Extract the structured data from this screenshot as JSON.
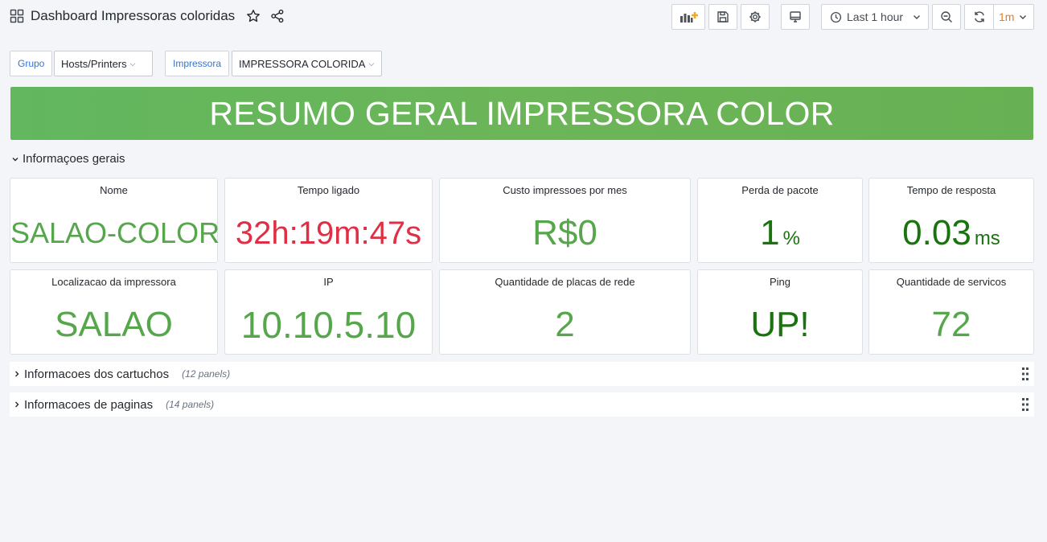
{
  "header": {
    "title": "Dashboard Impressoras coloridas",
    "time_range": "Last 1 hour",
    "refresh_interval": "1m"
  },
  "variables": [
    {
      "label": "Grupo",
      "value": "Hosts/Printers"
    },
    {
      "label": "Impressora",
      "value": "IMPRESSORA COLORIDA"
    }
  ],
  "banner": {
    "text": "RESUMO GERAL IMPRESSORA COLOR"
  },
  "rows": {
    "general": {
      "title": "Informaçoes gerais"
    },
    "cartridges": {
      "title": "Informacoes dos cartuchos",
      "count": "(12 panels)"
    },
    "pages": {
      "title": "Informacoes de paginas",
      "count": "(14 panels)"
    }
  },
  "panels": [
    {
      "title": "Nome",
      "value": "SALAO-COLOR",
      "unit": "",
      "color": "#56a64b"
    },
    {
      "title": "Tempo ligado",
      "value": "32h:19m:47s",
      "unit": "",
      "color": "#e02f44"
    },
    {
      "title": "Custo impressoes por mes",
      "value": "R$0",
      "unit": "",
      "color": "#56a64b"
    },
    {
      "title": "Perda de pacote",
      "value": "1",
      "unit": "%",
      "color": "#19730e"
    },
    {
      "title": "Tempo de resposta",
      "value": "0.03",
      "unit": "ms",
      "color": "#19730e"
    },
    {
      "title": "Localizacao da impressora",
      "value": "SALAO",
      "unit": "",
      "color": "#56a64b"
    },
    {
      "title": "IP",
      "value": "10.10.5.10",
      "unit": "",
      "color": "#56a64b"
    },
    {
      "title": "Quantidade de placas de rede",
      "value": "2",
      "unit": "",
      "color": "#56a64b"
    },
    {
      "title": "Ping",
      "value": "UP!",
      "unit": "",
      "color": "#19730e"
    },
    {
      "title": "Quantidade de servicos",
      "value": "72",
      "unit": "",
      "color": "#56a64b"
    }
  ],
  "colors": {
    "accent": "#3274d9",
    "refresh": "#eb7b18",
    "banner": "#6cb558"
  }
}
